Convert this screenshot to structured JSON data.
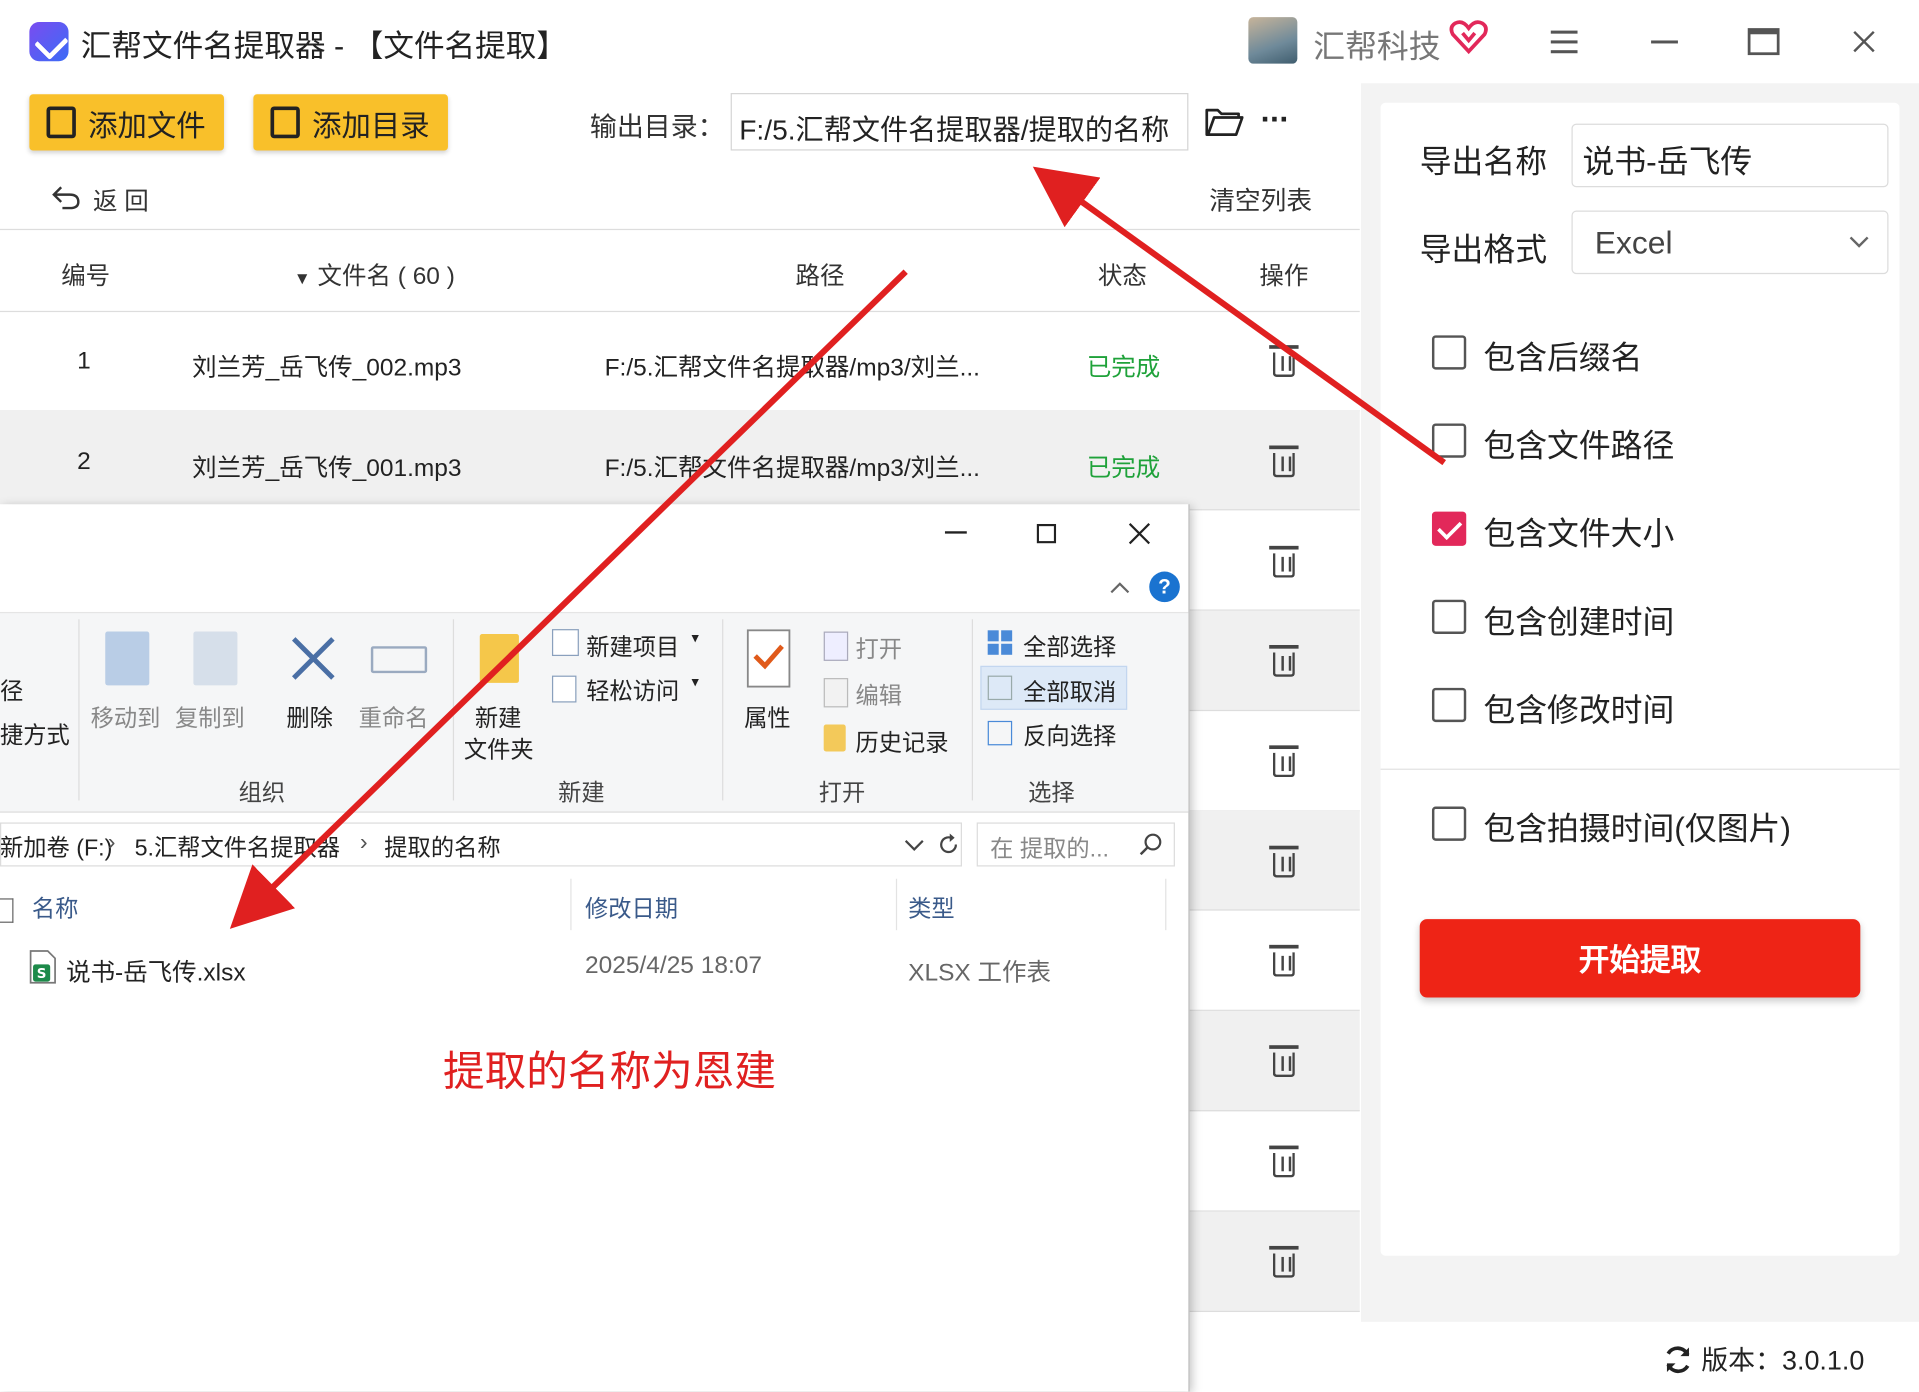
{
  "app": {
    "title": "汇帮文件名提取器 - 【文件名提取】",
    "brand": "汇帮科技",
    "version_label": "版本：3.0.1.0"
  },
  "toolbar": {
    "add_file": "添加文件",
    "add_dir": "添加目录",
    "output_label": "输出目录：",
    "output_path": "F:/5.汇帮文件名提取器/提取的名称",
    "more": "···",
    "back": "返 回",
    "clear_list": "清空列表"
  },
  "table": {
    "headers": {
      "num": "编号",
      "name": "文件名 ( 60 )",
      "path": "路径",
      "status": "状态",
      "action": "操作"
    },
    "rows": [
      {
        "num": "1",
        "name": "刘兰芳_岳飞传_002.mp3",
        "path": "F:/5.汇帮文件名提取器/mp3/刘兰...",
        "status": "已完成"
      },
      {
        "num": "2",
        "name": "刘兰芳_岳飞传_001.mp3",
        "path": "F:/5.汇帮文件名提取器/mp3/刘兰...",
        "status": "已完成"
      }
    ]
  },
  "panel": {
    "export_name_label": "导出名称",
    "export_name_value": "说书-岳飞传",
    "export_format_label": "导出格式",
    "export_format_value": "Excel",
    "options": [
      {
        "label": "包含后缀名",
        "checked": false
      },
      {
        "label": "包含文件路径",
        "checked": false
      },
      {
        "label": "包含文件大小",
        "checked": true
      },
      {
        "label": "包含创建时间",
        "checked": false
      },
      {
        "label": "包含修改时间",
        "checked": false
      },
      {
        "label": "包含拍摄时间(仅图片)",
        "checked": false
      }
    ],
    "start_button": "开始提取"
  },
  "explorer": {
    "ribbon": {
      "partial_left_1": "径",
      "partial_left_2": "捷方式",
      "move_to": "移动到",
      "copy_to": "复制到",
      "delete": "删除",
      "rename": "重命名",
      "new_folder_1": "新建",
      "new_folder_2": "文件夹",
      "new_item": "新建项目",
      "easy_access": "轻松访问",
      "properties": "属性",
      "open": "打开",
      "edit": "编辑",
      "history": "历史记录",
      "select_all": "全部选择",
      "select_none": "全部取消",
      "invert": "反向选择",
      "group_organize": "组织",
      "group_new": "新建",
      "group_open": "打开",
      "group_select": "选择"
    },
    "breadcrumb": [
      "新加卷 (F:)",
      "5.汇帮文件名提取器",
      "提取的名称"
    ],
    "search_placeholder": "在 提取的...",
    "columns": {
      "name": "名称",
      "modified": "修改日期",
      "type": "类型"
    },
    "files": [
      {
        "name": "说书-岳飞传.xlsx",
        "modified": "2025/4/25 18:07",
        "type": "XLSX 工作表"
      }
    ],
    "annotation": "提取的名称为恩建"
  },
  "colors": {
    "accent_yellow": "#f9c02a",
    "start_red": "#ee2416",
    "done_green": "#1fa23a",
    "check_pink": "#e2285a",
    "arrow_red": "#e02020"
  }
}
